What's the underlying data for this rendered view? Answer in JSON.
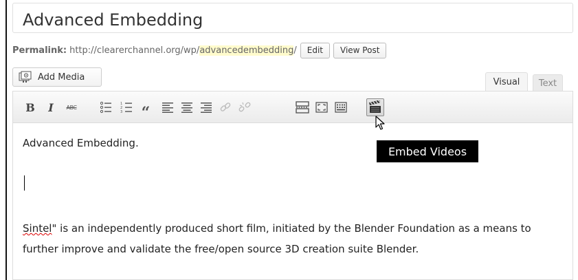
{
  "post": {
    "title": "Advanced Embedding"
  },
  "permalink": {
    "label": "Permalink:",
    "base_url": "http://clearerchannel.org/wp/",
    "slug": "advancedembedding",
    "trailing": "/",
    "edit_label": "Edit",
    "view_label": "View Post"
  },
  "media": {
    "add_label": "Add Media"
  },
  "tabs": [
    {
      "label": "Visual",
      "active": true
    },
    {
      "label": "Text",
      "active": false
    }
  ],
  "toolbar": {
    "buttons": [
      {
        "name": "bold",
        "glyph": "B"
      },
      {
        "name": "italic",
        "glyph": "I"
      },
      {
        "name": "strikethrough",
        "glyph": "ABC"
      },
      {
        "name": "bulleted-list",
        "icon": "bullet-list-icon"
      },
      {
        "name": "numbered-list",
        "icon": "numbered-list-icon"
      },
      {
        "name": "blockquote",
        "glyph": "“"
      },
      {
        "name": "align-left",
        "icon": "align-left-icon"
      },
      {
        "name": "align-center",
        "icon": "align-center-icon"
      },
      {
        "name": "align-right",
        "icon": "align-right-icon"
      },
      {
        "name": "insert-link",
        "icon": "link-icon"
      },
      {
        "name": "remove-link",
        "icon": "unlink-icon"
      },
      {
        "name": "read-more",
        "icon": "read-more-icon"
      },
      {
        "name": "fullscreen",
        "icon": "fullscreen-icon"
      },
      {
        "name": "kitchen-sink",
        "icon": "kitchen-sink-icon"
      },
      {
        "name": "embed-videos",
        "icon": "clapperboard-icon",
        "active": true
      }
    ],
    "tooltip": "Embed Videos"
  },
  "content": {
    "paragraph1": "Advanced Embedding.",
    "paragraph2_misspelled": "Sintel",
    "paragraph2_rest": "\" is an independently produced short film, initiated by the Blender Foundation as a means to further improve and validate the free/open source 3D creation suite Blender."
  },
  "colors": {
    "slug_highlight": "#fffbcc",
    "tooltip_bg": "#000000",
    "spellcheck": "#dd0000"
  }
}
